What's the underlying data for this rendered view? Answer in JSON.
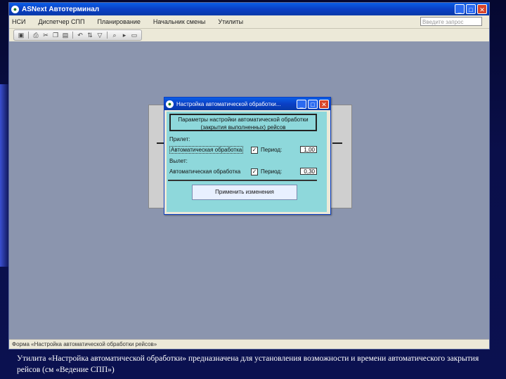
{
  "app": {
    "title": "ASNext Автотерминал",
    "menu": [
      "НСИ",
      "Диспетчер СПП",
      "Планирование",
      "Начальник смены",
      "Утилиты"
    ],
    "search_placeholder": "Введите запрос"
  },
  "toolbar": {
    "icons": [
      "save-icon",
      "print-icon",
      "cut-icon",
      "copy-icon",
      "paste-icon",
      "undo-icon",
      "sort-icon",
      "filter-icon",
      "find-icon",
      "nav-icon",
      "window-icon"
    ]
  },
  "status": {
    "text": "Форма «Настройка автоматической обработки рейсов»"
  },
  "dialog": {
    "title": "Настройка автоматической обработки...",
    "header": "Параметры настройки автоматической обработки (закрытия выполненных) рейсов",
    "arrival_label": "Прилет:",
    "arrival_auto_label": "Автоматическая обработка",
    "arrival_checked": true,
    "arrival_period_label": "Период:",
    "arrival_period_value": "1,00",
    "departure_label": "Вылет:",
    "departure_auto_label": "Автоматическая обработка",
    "departure_checked": true,
    "departure_period_label": "Период:",
    "departure_period_value": "0,30",
    "apply_label": "Применить изменения"
  },
  "caption": "Утилита «Настройка автоматической обработки» предназначена для установления возможности и времени автоматического закрытия рейсов (см «Ведение СПП»)",
  "colors": {
    "background": "#0a0f4a",
    "client": "#8b95ae",
    "dialog_body": "#8ed8db",
    "titlebar": "#0a3fc5"
  }
}
